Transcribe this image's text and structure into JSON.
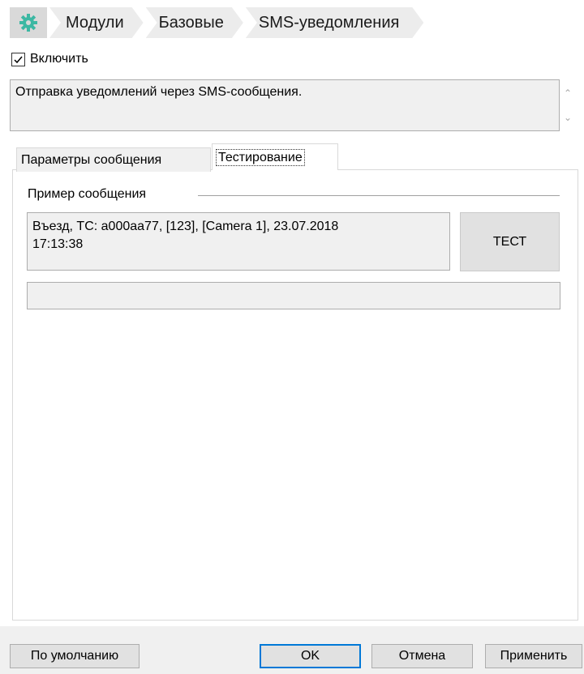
{
  "breadcrumb": {
    "icon": "gear-icon",
    "items": [
      "Модули",
      "Базовые",
      "SMS-уведомления"
    ]
  },
  "enable": {
    "label": "Включить",
    "checked": true
  },
  "description": "Отправка уведомлений через SMS-сообщения.",
  "tabs": [
    {
      "label": "Параметры сообщения",
      "active": false
    },
    {
      "label": "Тестирование",
      "active": true
    }
  ],
  "test_tab": {
    "group_label": "Пример сообщения",
    "message_line1": "Въезд, ТС: а000аа77, [123], [Camera 1], 23.07.2018",
    "message_line2": "17:13:38",
    "test_button": "ТЕСТ",
    "result_value": ""
  },
  "footer": {
    "default_button": "По умолчанию",
    "ok_button": "OK",
    "cancel_button": "Отмена",
    "apply_button": "Применить"
  },
  "colors": {
    "accent_gear": "#3cb8a3",
    "focus_border": "#0078d7"
  }
}
